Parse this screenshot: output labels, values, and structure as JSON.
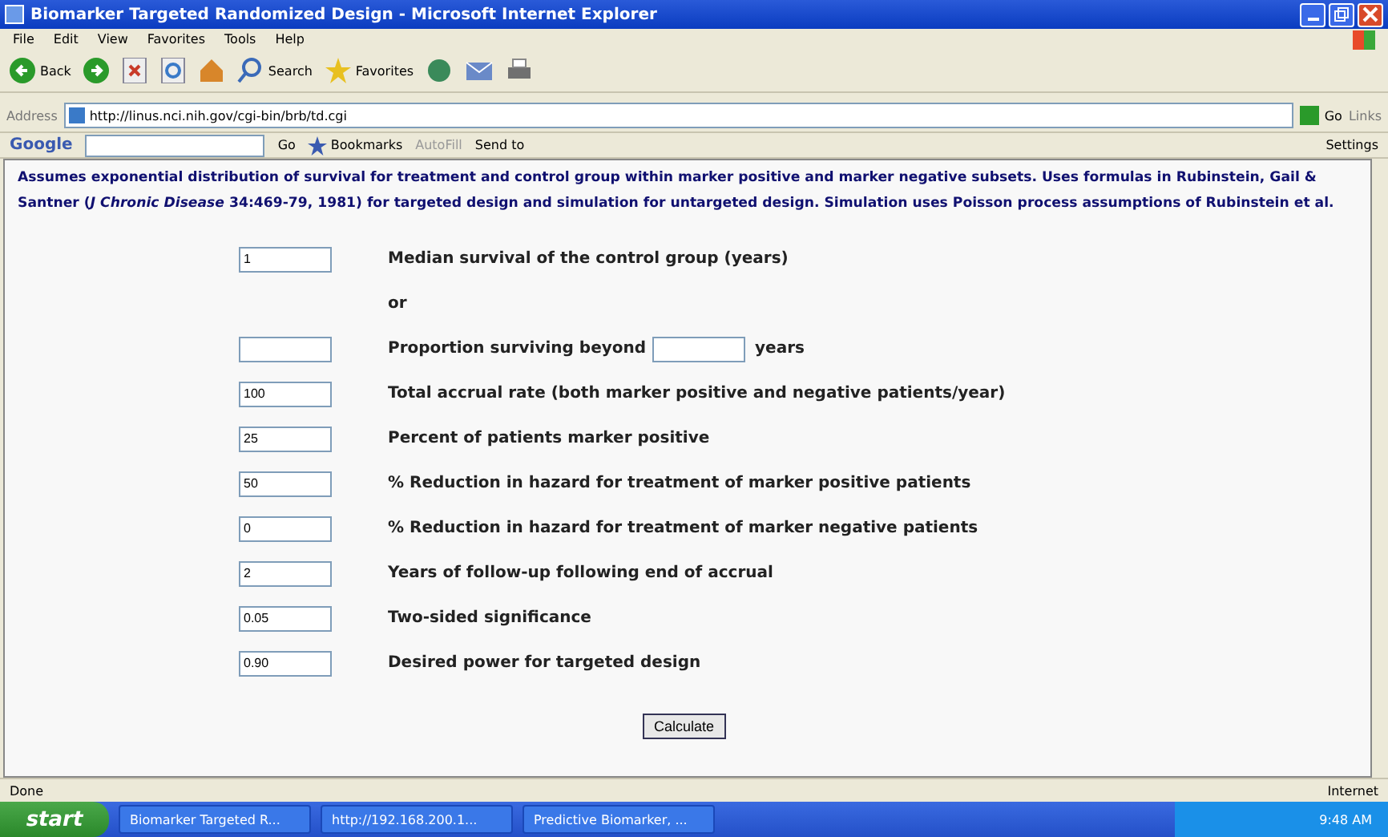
{
  "window": {
    "title": "Biomarker Targeted Randomized Design - Microsoft Internet Explorer"
  },
  "menu": [
    "File",
    "Edit",
    "View",
    "Favorites",
    "Tools",
    "Help"
  ],
  "toolbar": [
    {
      "kind": "back",
      "label": "Back"
    },
    {
      "kind": "forward"
    },
    {
      "kind": "stop"
    },
    {
      "kind": "refresh"
    },
    {
      "kind": "home"
    },
    {
      "kind": "search",
      "label": "Search"
    },
    {
      "kind": "favorites",
      "label": "Favorites"
    },
    {
      "kind": "media"
    },
    {
      "kind": "mail"
    },
    {
      "kind": "print"
    }
  ],
  "address": {
    "label": "Address",
    "url": "http://linus.nci.nih.gov/cgi-bin/brb/td.cgi",
    "go": "Go",
    "links": "Links"
  },
  "google": {
    "logo": "Google",
    "go": "Go",
    "bookmarks": "Bookmarks",
    "autofill": "AutoFill",
    "send": "Send to",
    "settings": "Settings"
  },
  "description": "Assumes exponential distribution of survival for treatment and control group within marker positive and marker negative subsets. Uses formulas in Rubinstein, Gail & Santner (*J Chronic Disease* 34:469-79, 1981) for targeted design and simulation for untargeted design. Simulation uses Poisson process assumptions of Rubinstein et al.",
  "rows": [
    {
      "kind": "field",
      "value": "1",
      "label": "Median survival of the control group (years)"
    },
    {
      "kind": "text",
      "label": "or"
    },
    {
      "kind": "inline",
      "label": "Proportion surviving beyond",
      "suffix": "years"
    },
    {
      "kind": "field",
      "value": "100",
      "label": "Total accrual rate (both marker positive and negative patients/year)"
    },
    {
      "kind": "field",
      "value": "25",
      "label": "Percent of patients marker positive"
    },
    {
      "kind": "field",
      "value": "50",
      "label": "% Reduction in hazard for treatment of marker positive patients"
    },
    {
      "kind": "field",
      "value": "0",
      "label": "% Reduction in hazard for treatment of marker negative patients"
    },
    {
      "kind": "field",
      "value": "2",
      "label": "Years of follow-up following end of accrual"
    },
    {
      "kind": "field",
      "value": "0.05",
      "label": "Two-sided significance"
    },
    {
      "kind": "field",
      "value": "0.90",
      "label": "Desired power for targeted design"
    }
  ],
  "button": "Calculate",
  "status": {
    "text": "Done",
    "zone": "Internet"
  },
  "taskbar": {
    "start": "start",
    "tasks": [
      "Biomarker Targeted R...",
      "http://192.168.200.1...",
      "Predictive Biomarker, ..."
    ],
    "time": "9:48 AM"
  }
}
